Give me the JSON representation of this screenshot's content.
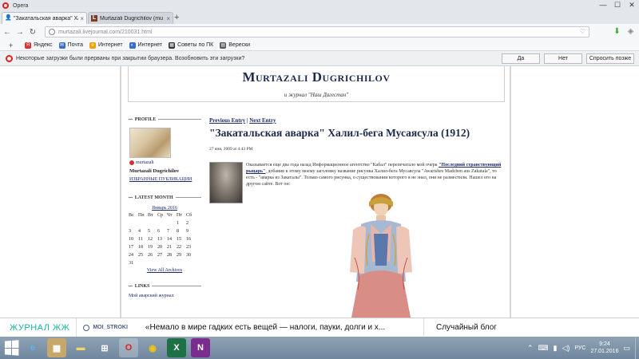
{
  "window": {
    "app_name": "Opera",
    "controls": [
      "—",
      "☐",
      "✕"
    ]
  },
  "tabs": [
    {
      "label": "\"Закатальская аварка\" Ха",
      "active": true,
      "favicon": "lj-user-icon"
    },
    {
      "label": "Murtazali Dugrichilov (mu",
      "active": false,
      "favicon": "lj-l-icon"
    }
  ],
  "new_tab_label": "+",
  "address": {
    "url": "murtazali.livejournal.com/210031.html"
  },
  "bookmarks": [
    {
      "label": "Яндекс",
      "color": "#e62d2d",
      "glyph": "Я"
    },
    {
      "label": "Почта",
      "color": "#3a6dc7",
      "glyph": "✉"
    },
    {
      "label": "Интернет",
      "color": "#f0a000",
      "glyph": "e"
    },
    {
      "label": "Интернет",
      "color": "#3a6dc7",
      "glyph": "◐"
    },
    {
      "label": "Советы по ПК",
      "color": "#333333",
      "glyph": "▦"
    },
    {
      "label": "Верески",
      "color": "#555555",
      "glyph": "▤"
    }
  ],
  "notification": {
    "message": "Некоторые загрузки были прерваны при закрытии браузера. Возобновить эти загрузки?",
    "buttons": [
      "Да",
      "Нет",
      "Спросить позже"
    ]
  },
  "journal": {
    "title": "Murtazali Dugrichilov",
    "subtitle": "и журнал \"Наш Дагестан\""
  },
  "sidebar": {
    "profile_heading": "Profile",
    "username": "murtazali",
    "full_name": "Murtazali Dugrichilov",
    "favorites_link": "ИЗБРАННЫЕ ПУБЛИКАЦИИ",
    "latest_month_heading": "Latest Month",
    "calendar": {
      "month": "Январь 2016",
      "weekdays": [
        "Вс",
        "Пн",
        "Вт",
        "Ср",
        "Чт",
        "Пт",
        "Сб"
      ],
      "weeks": [
        [
          "",
          "",
          "",
          "",
          "",
          "1",
          "2"
        ],
        [
          "3",
          "4",
          "5",
          "6",
          "7",
          "8",
          "9"
        ],
        [
          "10",
          "11",
          "12",
          "13",
          "14",
          "15",
          "16"
        ],
        [
          "17",
          "18",
          "19",
          "20",
          "21",
          "22",
          "23"
        ],
        [
          "24",
          "25",
          "26",
          "27",
          "28",
          "29",
          "30"
        ],
        [
          "31",
          "",
          "",
          "",
          "",
          "",
          ""
        ]
      ],
      "view_all": "View All Archives"
    },
    "links_heading": "Links",
    "links": [
      "Мой аварский журнал"
    ]
  },
  "entry": {
    "prev_label": "Previous Entry",
    "divider": " | ",
    "next_label": "Next Entry",
    "title": "\"Закатальская аварка\" Халил-бега Мусаясула (1912)",
    "date": "27 янв, 2009 at 4:43 PM",
    "text_before": "Оказывается еще два года назад Информационное агентство \"Кабал\" перепечатало мой очерк ",
    "link_text": "\"Последний странствующий рыцарь\"",
    "text_after": ", добавив к этому моему заголовку название рисунка Халил-бега Мусаясула \"Awarishes Madchen aus Zakatala\", то есть - \"аварка из Закаталы\". Только самого рисунка, о существовании которого я не знал, они не разместили. Нашел его на другом сайте. Вот он:"
  },
  "ljbar": {
    "brand": "ЖУРНАЛ ЖЖ",
    "author": "MOI_STROKI",
    "post": "«Немало в мире гадких есть вещей — налоги, пауки, долги и х...",
    "random": "Случайный блог"
  },
  "taskbar": {
    "language": "РУС",
    "time": "9:24",
    "date": "27.01.2016"
  }
}
